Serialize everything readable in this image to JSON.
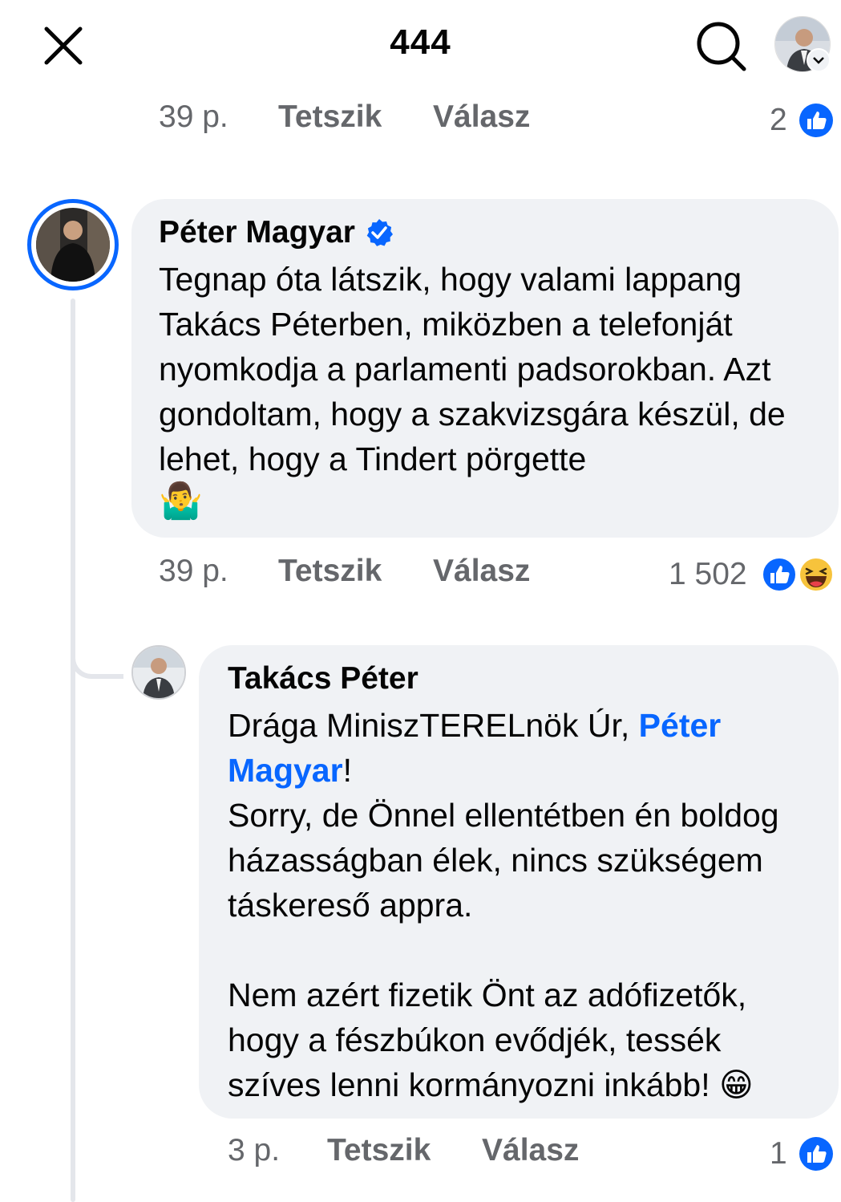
{
  "header": {
    "title": "444"
  },
  "top_comment_meta": {
    "time": "39 p.",
    "like_label": "Tetszik",
    "reply_label": "Válasz",
    "reaction_count": "2"
  },
  "comment_1": {
    "author": "Péter Magyar",
    "verified": true,
    "text": "Tegnap óta látszik, hogy valami lappang Takács Péterben, miközben a telefonját nyomkodja a parlamenti padsorokban. Azt gondoltam, hogy a szakvizsgára készül, de lehet, hogy a Tindert pörgette",
    "emoji": "🤷‍♂️",
    "time": "39 p.",
    "like_label": "Tetszik",
    "reply_label": "Válasz",
    "reaction_count": "1 502"
  },
  "reply_1": {
    "author": "Takács Péter",
    "text_before_mention": "Drága MiniszTERELnök Úr, ",
    "mention_first": "Péter",
    "mention_second": "Magyar",
    "text_after_mention": "!",
    "paragraph_2": "Sorry, de Önnel ellentétben én boldog házasságban élek, nincs szükségem táskereső appra.",
    "paragraph_3": "Nem azért fizetik Önt az adófizetők, hogy a fészbúkon evődjék, tessék szíves lenni kormányozni inkább!",
    "emoji": "😁",
    "time": "3 p.",
    "like_label": "Tetszik",
    "reply_label": "Válasz",
    "reaction_count": "1"
  },
  "colors": {
    "facebook_blue": "#0866ff",
    "bubble_bg": "#f0f2f5",
    "meta_gray": "#65676b"
  },
  "icons": [
    "close-icon",
    "search-icon",
    "chevron-down-icon",
    "verified-badge-icon",
    "like-reaction-icon",
    "haha-reaction-icon"
  ]
}
